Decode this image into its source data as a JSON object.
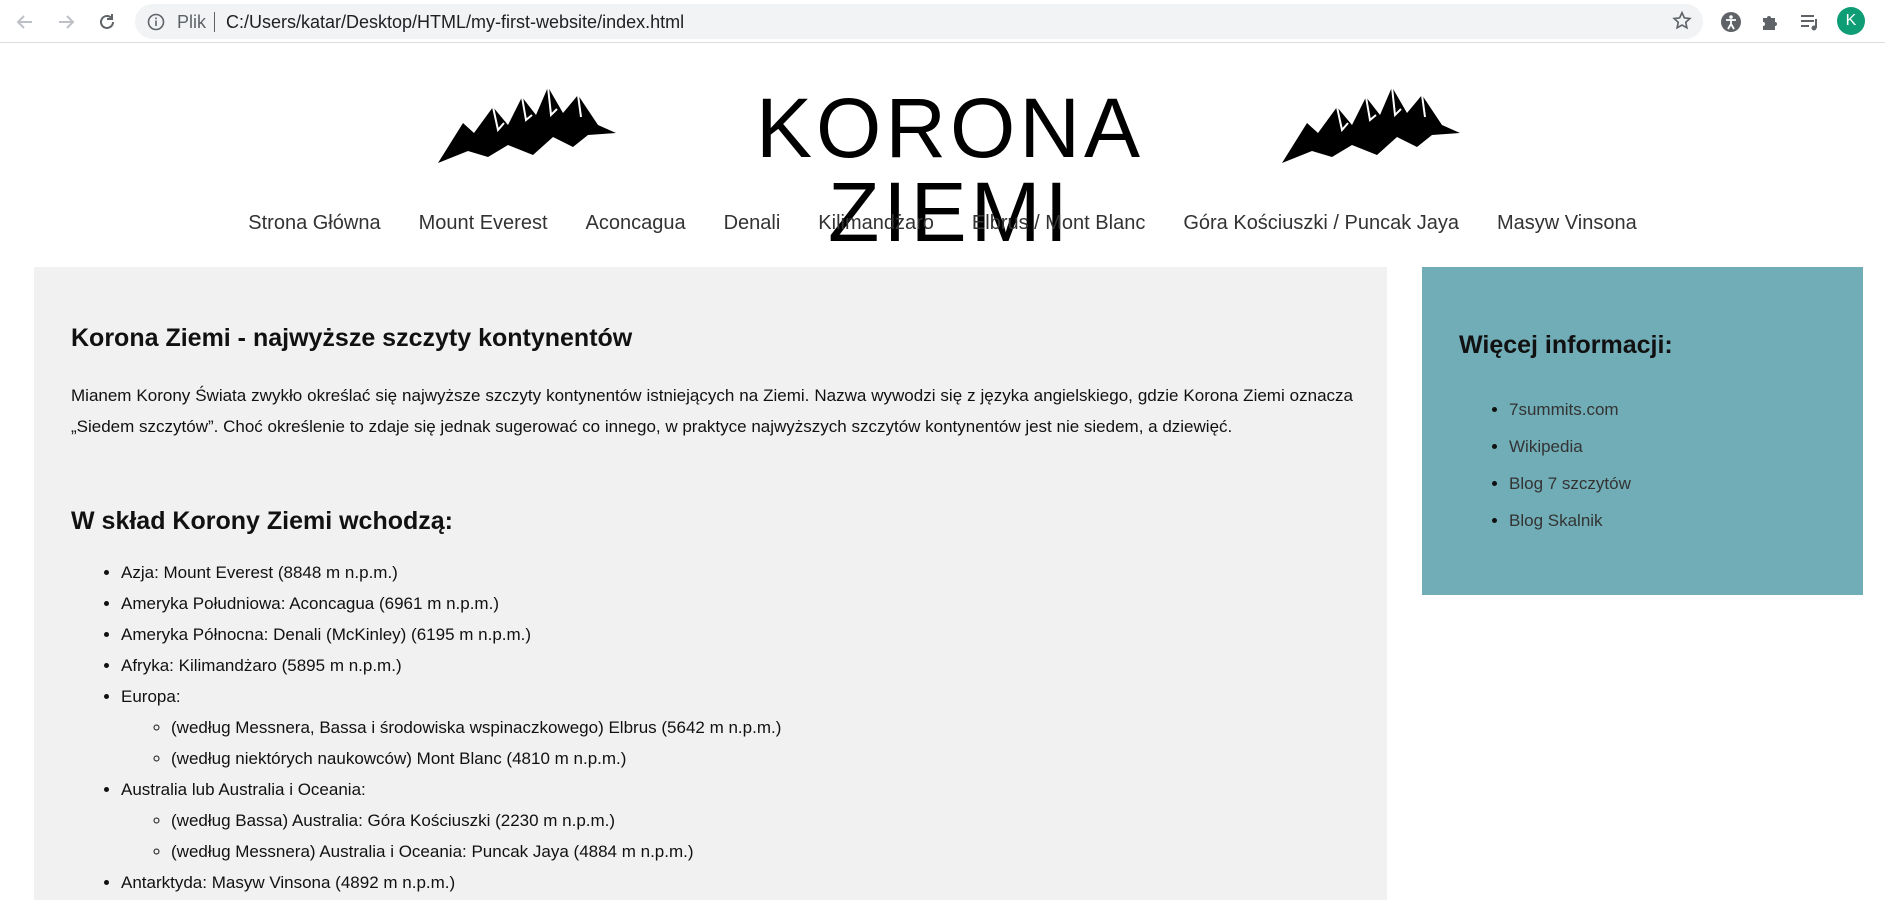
{
  "browser": {
    "scheme_label": "Plik",
    "url": "C:/Users/katar/Desktop/HTML/my-first-website/index.html",
    "avatar_letter": "K"
  },
  "header": {
    "logo_text": "KORONA ZIEMI"
  },
  "nav": [
    "Strona Główna",
    "Mount Everest",
    "Aconcagua",
    "Denali",
    "Kilimandżaro",
    "Elbrus / Mont Blanc",
    "Góra Kościuszki / Puncak Jaya",
    "Masyw Vinsona"
  ],
  "main": {
    "title": "Korona Ziemi - najwyższe szczyty kontynentów",
    "intro": "Mianem Korony Świata zwykło określać się najwyższe szczyty kontynentów istniejących na Ziemi. Nazwa wywodzi się z języka angielskiego, gdzie Korona Ziemi oznacza „Siedem szczytów”. Choć określenie to zdaje się jednak sugerować co innego, w praktyce najwyższych szczytów kontynentów jest nie siedem, a dziewięć.",
    "subtitle": "W skład Korony Ziemi wchodzą:",
    "peaks": {
      "asia": "Azja: Mount Everest (8848 m n.p.m.)",
      "south_america": "Ameryka Południowa: Aconcagua (6961 m n.p.m.)",
      "north_america": "Ameryka Północna: Denali (McKinley) (6195 m n.p.m.)",
      "africa": "Afryka: Kilimandżaro (5895 m n.p.m.)",
      "europe": "Europa:",
      "europe_1": "(według Messnera, Bassa i środowiska wspinaczkowego) Elbrus (5642 m n.p.m.)",
      "europe_2": "(według niektórych naukowców) Mont Blanc (4810 m n.p.m.)",
      "australia": "Australia lub Australia i Oceania:",
      "australia_1": "(według Bassa) Australia: Góra Kościuszki (2230 m n.p.m.)",
      "australia_2": "(według Messnera) Australia i Oceania: Puncak Jaya (4884 m n.p.m.)",
      "antarctica": "Antarktyda: Masyw Vinsona (4892 m n.p.m.)"
    }
  },
  "sidebar": {
    "title": "Więcej informacji:",
    "links": [
      "7summits.com",
      "Wikipedia",
      "Blog 7 szczytów",
      "Blog Skalnik"
    ]
  },
  "colors": {
    "main_bg": "#f1f1f1",
    "sidebar_bg": "#70adb6"
  }
}
